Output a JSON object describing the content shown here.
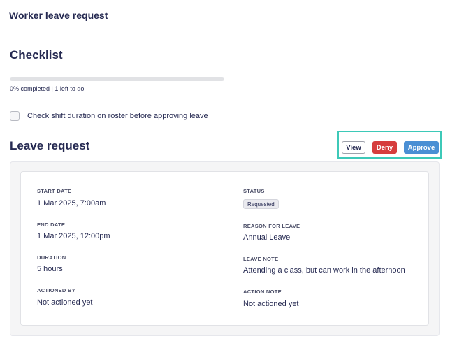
{
  "header": {
    "title": "Worker leave request"
  },
  "checklist": {
    "title": "Checklist",
    "progress_fraction": 0,
    "progress_text": "0% completed | 1 left to do",
    "items": [
      {
        "label": "Check shift duration on roster before approving leave",
        "checked": false
      }
    ]
  },
  "leave_request": {
    "title": "Leave request",
    "actions": {
      "view": "View",
      "deny": "Deny",
      "approve": "Approve"
    },
    "fields": {
      "start_date": {
        "label": "START DATE",
        "value": "1 Mar 2025, 7:00am"
      },
      "end_date": {
        "label": "END DATE",
        "value": "1 Mar 2025, 12:00pm"
      },
      "duration": {
        "label": "DURATION",
        "value": "5 hours"
      },
      "actioned_by": {
        "label": "ACTIONED BY",
        "value": "Not actioned yet"
      },
      "status": {
        "label": "STATUS",
        "value": "Requested"
      },
      "reason": {
        "label": "REASON FOR LEAVE",
        "value": "Annual Leave"
      },
      "leave_note": {
        "label": "LEAVE NOTE",
        "value": "Attending a class, but can work in the afternoon"
      },
      "action_note": {
        "label": "ACTION NOTE",
        "value": "Not actioned yet"
      }
    }
  },
  "colors": {
    "primary_text": "#262a52",
    "approve": "#4a8fd4",
    "deny": "#d63d3d",
    "highlight_border": "#3dc9b8"
  }
}
